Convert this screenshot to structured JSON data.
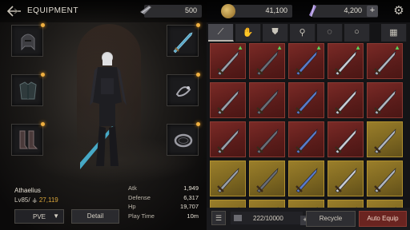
{
  "header": {
    "title": "EQUIPMENT",
    "currency": [
      {
        "name": "soul-stones",
        "value": "500"
      },
      {
        "name": "gold",
        "value": "41,100"
      },
      {
        "name": "crystals",
        "value": "4,200"
      }
    ],
    "plus_label": "+"
  },
  "character": {
    "name": "Athaelius",
    "level_label": "Lv85/",
    "power": "27,119",
    "stats": [
      {
        "label": "Atk",
        "value": "1,949"
      },
      {
        "label": "Defense",
        "value": "6,317"
      },
      {
        "label": "Hp",
        "value": "19,707"
      },
      {
        "label": "Play Time",
        "value": "10m"
      }
    ],
    "mode": "PVE",
    "detail_label": "Detail"
  },
  "slots": [
    "helmet",
    "chest-armor",
    "boots",
    "sword",
    "ring",
    "bracelet"
  ],
  "inventory": {
    "tabs": [
      "sword-icon",
      "gloves-icon",
      "armor-icon",
      "boots-icon",
      "necklace-icon",
      "ring-icon",
      "grid-icon"
    ],
    "active_tab": 0,
    "items": [
      {
        "rarity": "red",
        "up": true
      },
      {
        "rarity": "red",
        "up": true
      },
      {
        "rarity": "red",
        "up": true
      },
      {
        "rarity": "red",
        "up": true
      },
      {
        "rarity": "red",
        "up": true
      },
      {
        "rarity": "red",
        "up": false
      },
      {
        "rarity": "red",
        "up": false
      },
      {
        "rarity": "red",
        "up": false
      },
      {
        "rarity": "red",
        "up": false
      },
      {
        "rarity": "red",
        "up": false
      },
      {
        "rarity": "red",
        "up": false
      },
      {
        "rarity": "red",
        "up": false
      },
      {
        "rarity": "red",
        "up": false
      },
      {
        "rarity": "red",
        "up": false
      },
      {
        "rarity": "gold",
        "up": false
      },
      {
        "rarity": "gold",
        "up": false
      },
      {
        "rarity": "gold",
        "up": false
      },
      {
        "rarity": "gold",
        "up": false
      },
      {
        "rarity": "gold",
        "up": false
      },
      {
        "rarity": "gold",
        "up": false
      },
      {
        "rarity": "gold",
        "up": false
      },
      {
        "rarity": "gold",
        "up": false
      },
      {
        "rarity": "gold",
        "up": false
      },
      {
        "rarity": "gold",
        "up": false
      },
      {
        "rarity": "gold",
        "up": false
      }
    ],
    "capacity": "222/10000",
    "capacity_plus": "+",
    "recycle_label": "Recycle",
    "auto_equip_label": "Auto Equip"
  },
  "colors": {
    "red_rarity": "#7a2a26",
    "gold_rarity": "#9a7e2a",
    "power": "#d9a53a",
    "upgrade_arrow": "#5fd05a",
    "accent_button": "#6a2420"
  }
}
